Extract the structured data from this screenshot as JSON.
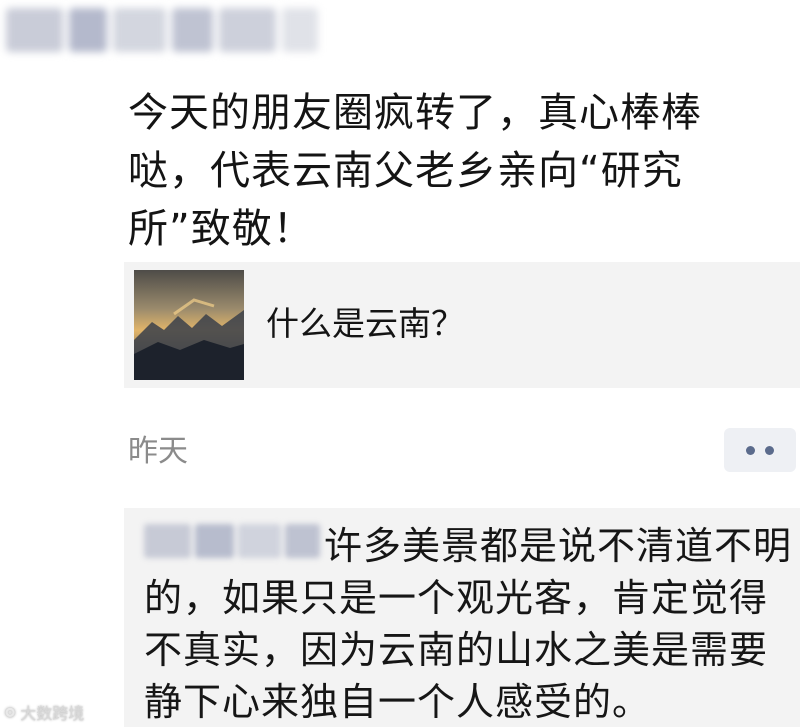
{
  "post": {
    "text": "今天的朋友圈疯转了，真心棒棒哒，代表云南父老乡亲向“研究所”致敬！"
  },
  "link_card": {
    "title": "什么是云南？"
  },
  "meta": {
    "time": "昨天"
  },
  "comment": {
    "text": "许多美景都是说不清道不明的，如果只是一个观光客，肯定觉得不真实，因为云南的山水之美是需要静下心来独自一个人感受的。"
  },
  "watermark": {
    "text": "大数跨境"
  },
  "colors": {
    "secondary_text": "#8b8b8b",
    "card_bg": "#f3f3f3",
    "more_dots": "#5b6b8c"
  }
}
